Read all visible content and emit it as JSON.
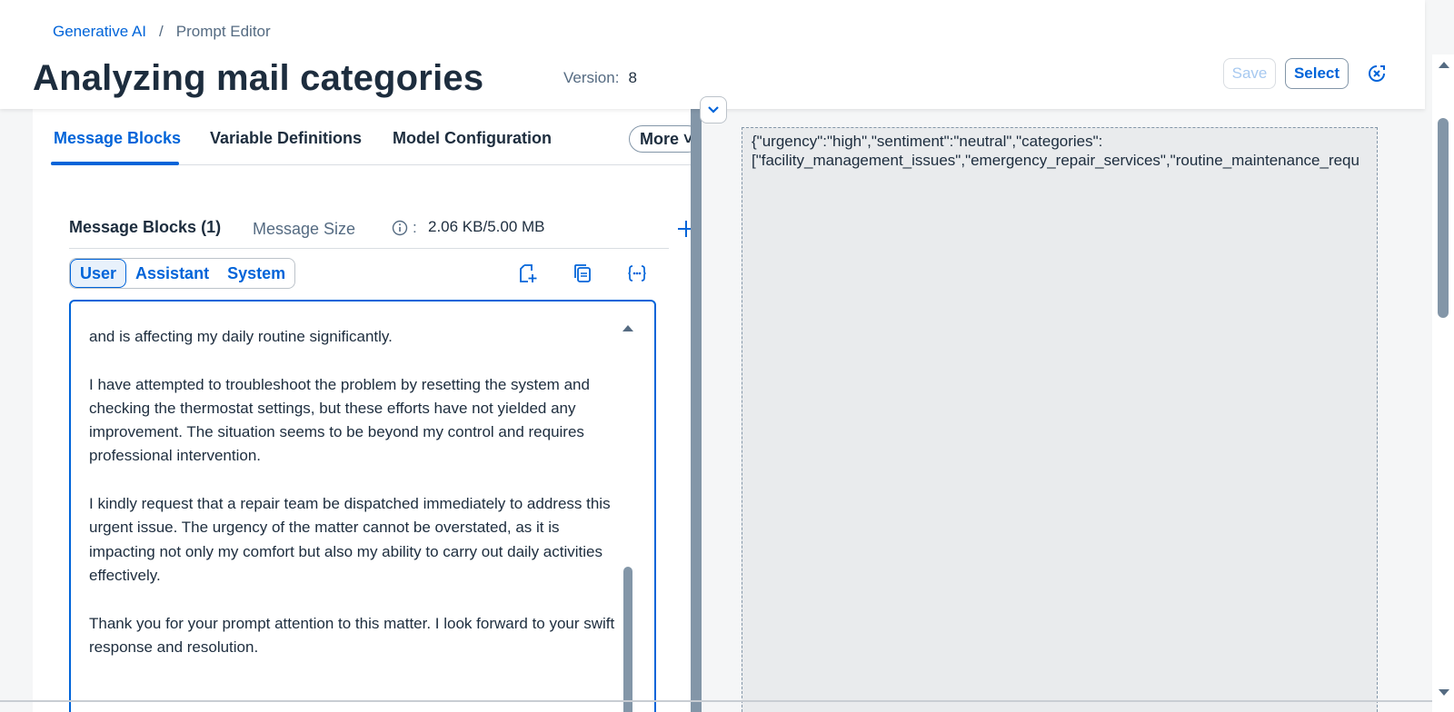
{
  "breadcrumb": {
    "root": "Generative AI",
    "separator": "/",
    "current": "Prompt Editor"
  },
  "header": {
    "title": "Analyzing mail categories",
    "version_label": "Version:",
    "version_value": "8",
    "save_label": "Save",
    "select_label": "Select"
  },
  "tabs": [
    {
      "label": "Message Blocks",
      "active": true
    },
    {
      "label": "Variable Definitions",
      "active": false
    },
    {
      "label": "Model Configuration",
      "active": false
    }
  ],
  "more_label": "More",
  "message_blocks": {
    "title": "Message Blocks (1)",
    "size_label": "Message Size",
    "size_colon": ":",
    "size_value": "2.06 KB/5.00 MB",
    "roles": [
      "User",
      "Assistant",
      "System"
    ],
    "selected_role": "User",
    "editor_text": "and is affecting my daily routine significantly.\n\nI have attempted to troubleshoot the problem by resetting the system and checking the thermostat settings, but these efforts have not yielded any improvement. The situation seems to be beyond my control and requires professional intervention.\n\nI kindly request that a repair team be dispatched immediately to address this urgent issue. The urgency of the matter cannot be overstated, as it is impacting not only my comfort but also my ability to carry out daily activities effectively.\n\nThank you for your prompt attention to this matter. I look forward to your swift response and resolution."
  },
  "output": {
    "text": "{\"urgency\":\"high\",\"sentiment\":\"neutral\",\"categories\":\n[\"facility_management_issues\",\"emergency_repair_services\",\"routine_maintenance_requ"
  },
  "icons": [
    "close-circle-icon",
    "chevron-down-icon",
    "info-icon",
    "add-icon",
    "add-document-icon",
    "copy-icon",
    "variable-braces-icon"
  ],
  "colors": {
    "accent": "#0064d9",
    "text": "#1d2d3e",
    "muted": "#556b82",
    "output_bg": "#e9ebed"
  }
}
